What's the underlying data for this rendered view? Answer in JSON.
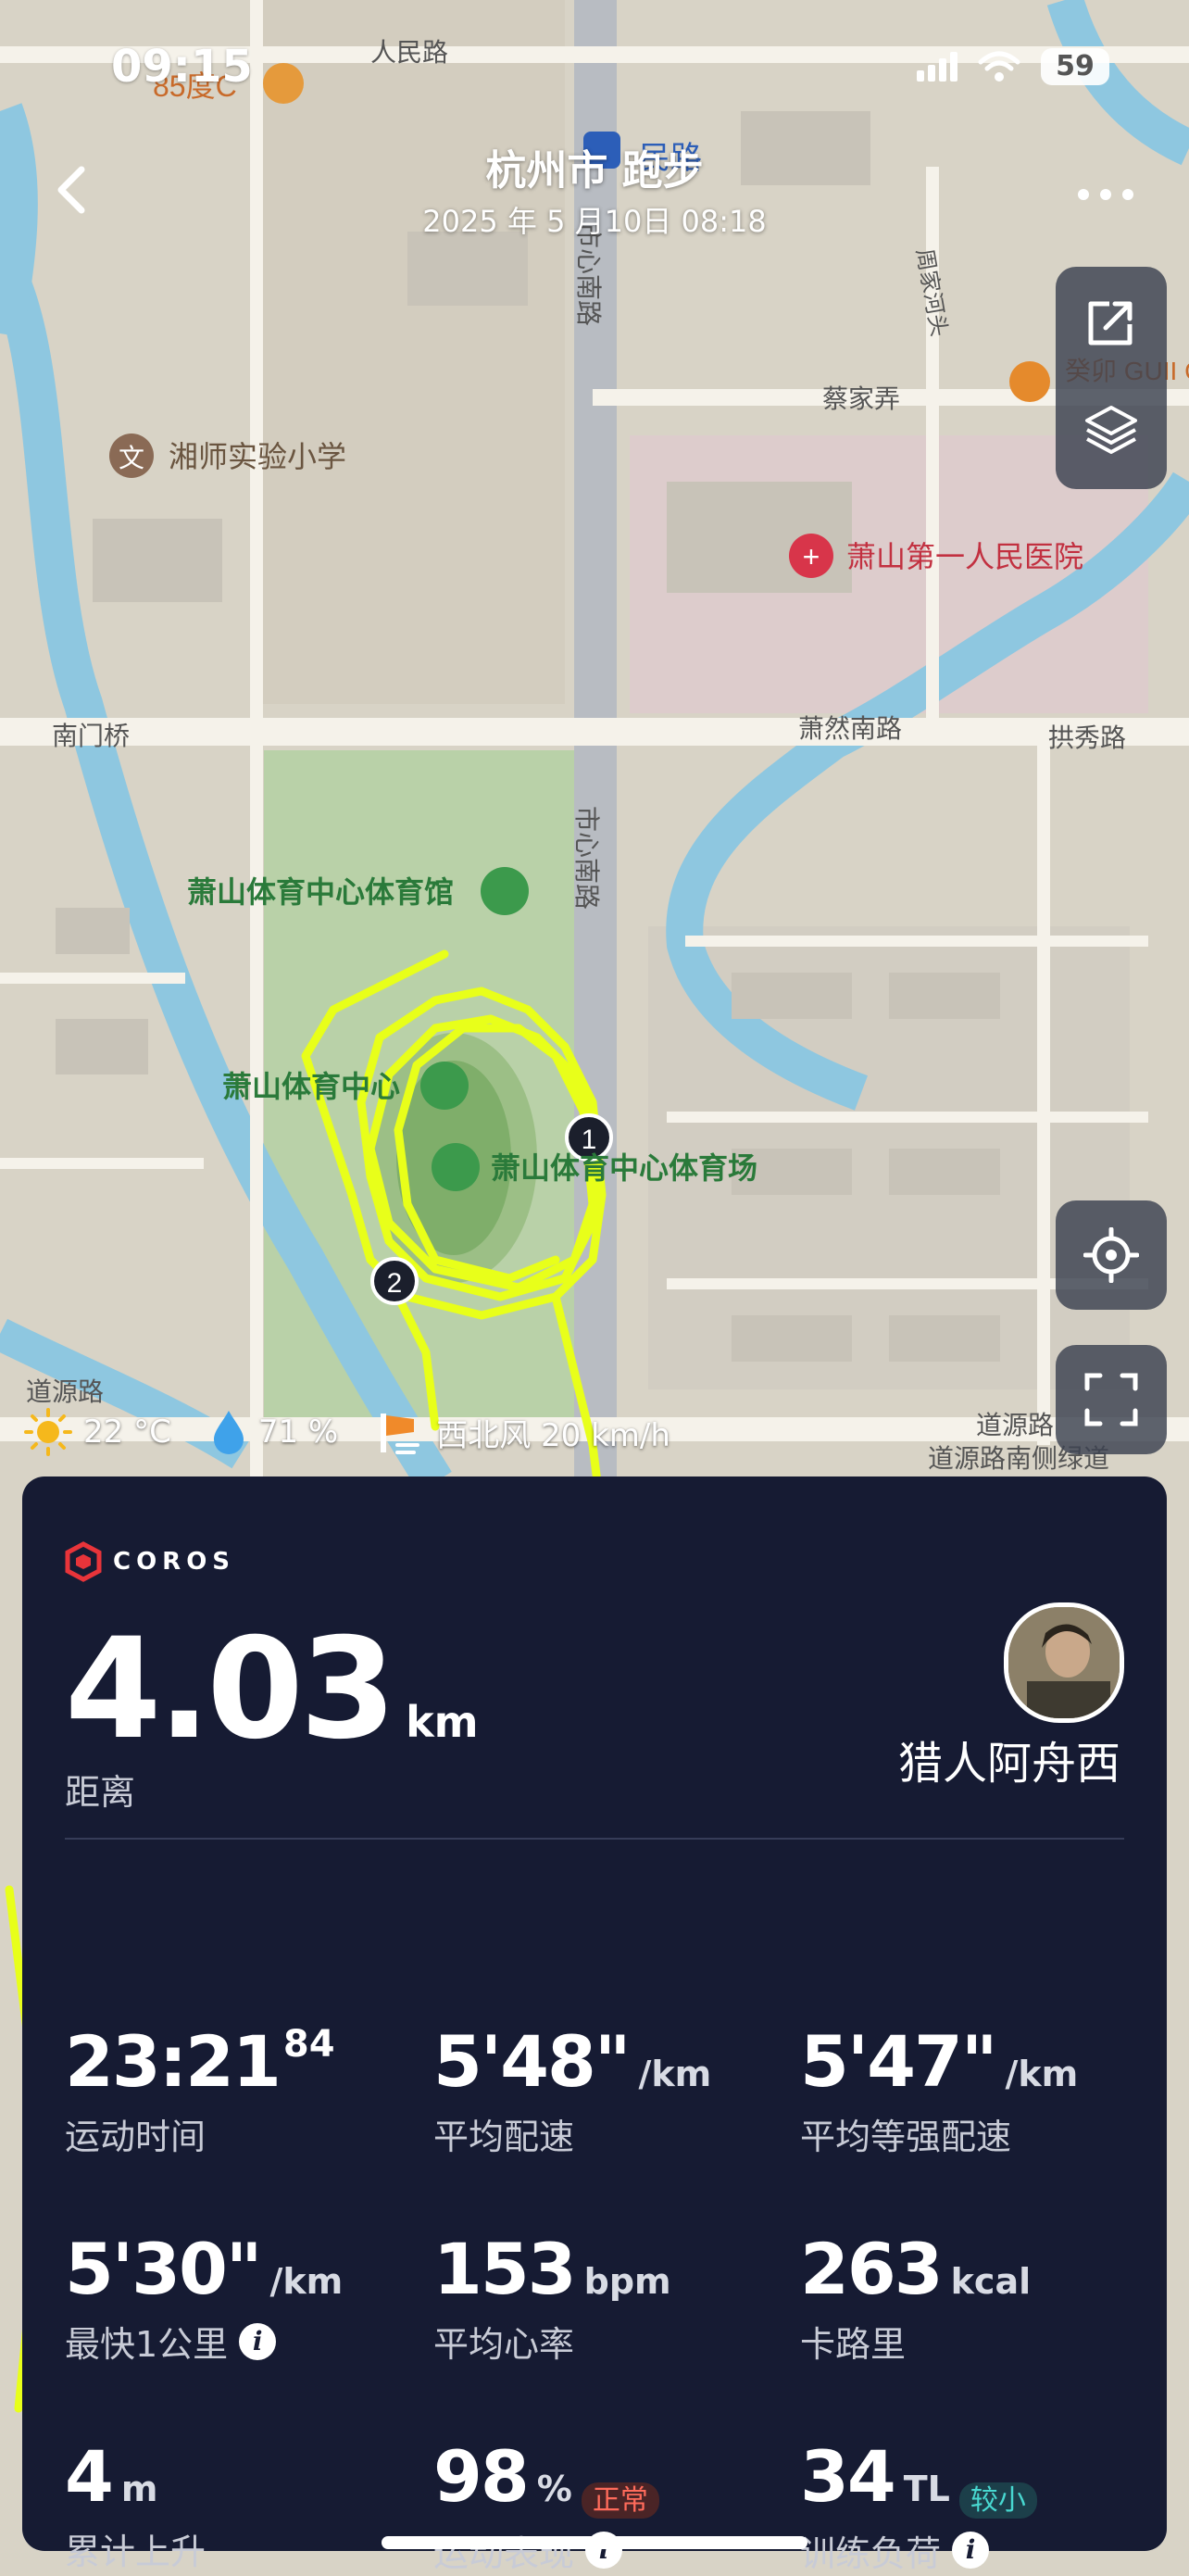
{
  "status_bar": {
    "time": "09:15",
    "battery": "59"
  },
  "header": {
    "title": "杭州市 跑步",
    "subtitle": "2025 年 5 月10日 08:18"
  },
  "map": {
    "labels": {
      "renmin_road": "人民路",
      "bakery": "85度C",
      "xiangshi_school": "湘师实验小学",
      "street_shixinnan_top": "市心南路",
      "zhoujia_river": "周家河头",
      "caijia_lane": "蔡家弄",
      "cafe": "癸卯 GUII COFFEE",
      "hospital": "萧山第一人民医院",
      "nanmen_bridge": "南门桥",
      "xiaoran_road": "萧然南路",
      "gongxiu_road": "拱秀路",
      "gymnasium": "萧山体育中心体育馆",
      "street_shixinnan": "市心南路",
      "sports_center": "萧山体育中心",
      "stadium": "萧山体育中心体育场",
      "daoyuan_road_left": "道源路",
      "daoyuan_road_right": "道源路",
      "daoyuan_side": "道源路南侧绿道",
      "marker_1": "1",
      "marker_2": "2",
      "top_partial": "民路"
    }
  },
  "weather": {
    "temperature": "22 °C",
    "humidity": "71 %",
    "wind": "西北风 20 km/h"
  },
  "card": {
    "brand": "COROS",
    "distance": {
      "value": "4.03",
      "unit": "km",
      "label": "距离"
    },
    "user": {
      "name": "猎人阿舟西"
    },
    "stats": [
      {
        "value": "23:21",
        "sup": "84",
        "unit": "",
        "label": "运动时间"
      },
      {
        "value": "5'48\"",
        "unit": "/km",
        "label": "平均配速"
      },
      {
        "value": "5'47\"",
        "unit": "/km",
        "label": "平均等强配速"
      },
      {
        "value": "5'30\"",
        "unit": "/km",
        "label": "最快1公里"
      },
      {
        "value": "153",
        "unit": "bpm",
        "label": "平均心率"
      },
      {
        "value": "263",
        "unit": "kcal",
        "label": "卡路里"
      },
      {
        "value": "4",
        "unit": "m",
        "label": "累计上升"
      },
      {
        "value": "98",
        "unit": "%",
        "badge": "正常",
        "label": "运动表现"
      },
      {
        "value": "34",
        "unit": "TL",
        "badge": "较小",
        "label": "训练负荷"
      }
    ]
  },
  "colors": {
    "card_bg": "#161b33",
    "route": "#e8ff1a",
    "brand_red": "#e8343a"
  }
}
